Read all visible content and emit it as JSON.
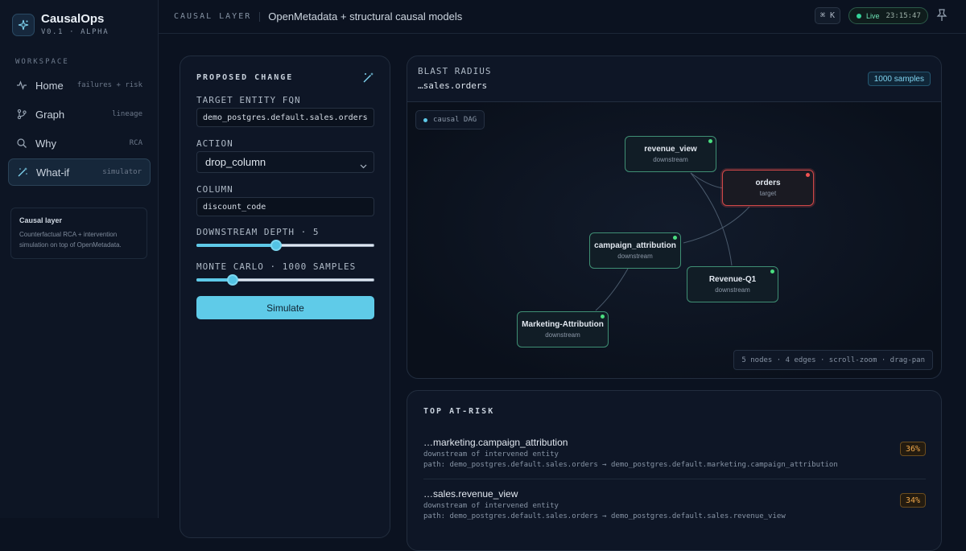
{
  "brand": {
    "name": "CausalOps",
    "version": "V0.1 · ALPHA"
  },
  "sidebar": {
    "section_label": "WORKSPACE",
    "items": [
      {
        "label": "Home",
        "hint": "failures + risk",
        "icon": "pulse-icon"
      },
      {
        "label": "Graph",
        "hint": "lineage",
        "icon": "branch-icon"
      },
      {
        "label": "Why",
        "hint": "RCA",
        "icon": "search-icon"
      },
      {
        "label": "What-if",
        "hint": "simulator",
        "icon": "wand-icon",
        "active": true
      }
    ],
    "info": {
      "title": "Causal layer",
      "body": "Counterfactual RCA + intervention simulation on top of OpenMetadata."
    }
  },
  "header": {
    "crumb": "CAUSAL LAYER",
    "title": "OpenMetadata + structural causal models",
    "shortcut": "⌘ K",
    "live_label": "Live",
    "live_time": "23:15:47"
  },
  "proposed": {
    "title": "PROPOSED CHANGE",
    "target_label": "TARGET ENTITY FQN",
    "target_value": "demo_postgres.default.sales.orders",
    "action_label": "ACTION",
    "action_value": "drop_column",
    "column_label": "COLUMN",
    "column_value": "discount_code",
    "depth_label": "DOWNSTREAM DEPTH · 5",
    "depth": {
      "value": 5,
      "min": 1,
      "max": 10
    },
    "monte_label": "MONTE CARLO · 1000 SAMPLES",
    "monte": {
      "value": 1000,
      "min": 100,
      "max": 5000
    },
    "simulate_label": "Simulate"
  },
  "blast": {
    "label": "BLAST RADIUS",
    "entity": "…sales.orders",
    "samples_badge": "1000 samples",
    "dag_chip": "causal DAG",
    "footer": "5 nodes · 4 edges · scroll-zoom · drag-pan",
    "nodes": [
      {
        "name": "revenue_view",
        "role": "downstream"
      },
      {
        "name": "orders",
        "role": "target"
      },
      {
        "name": "campaign_attribution",
        "role": "downstream"
      },
      {
        "name": "Revenue-Q1",
        "role": "downstream"
      },
      {
        "name": "Marketing-Attribution",
        "role": "downstream"
      }
    ]
  },
  "risk": {
    "title": "TOP AT-RISK",
    "items": [
      {
        "name": "…marketing.campaign_attribution",
        "sub": "downstream of intervened entity",
        "path": "path: demo_postgres.default.sales.orders → demo_postgres.default.marketing.campaign_attribution",
        "pct": "36%"
      },
      {
        "name": "…sales.revenue_view",
        "sub": "downstream of intervened entity",
        "path": "path: demo_postgres.default.sales.orders → demo_postgres.default.sales.revenue_view",
        "pct": "34%"
      }
    ]
  },
  "colors": {
    "accent": "#5fcbe8",
    "healthy": "#3f8f74",
    "target": "#d04848",
    "warning": "#f0a84a"
  }
}
